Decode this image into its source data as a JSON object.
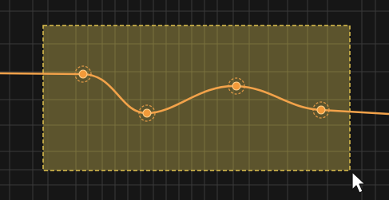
{
  "editor": {
    "background": "#161616",
    "grid_color": "#3a3a3a",
    "selection_fill": "#6b6232",
    "selection_border": "#e0c24e",
    "curve_color": "#f2a24a",
    "keyframe_color": "#f29a3a",
    "cursor_icon": "arrow-pointer-icon",
    "keyframe_count": 4,
    "selection_state": "selected"
  }
}
